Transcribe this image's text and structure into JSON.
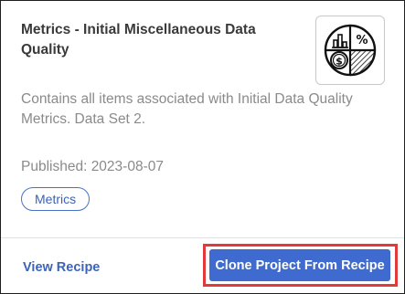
{
  "card": {
    "title": "Metrics - Initial Miscellaneous Data Quality",
    "description": "Contains all items associated with Initial Data Quality Metrics. Data Set 2.",
    "published": "Published: 2023-08-07",
    "tag": "Metrics",
    "icon": "metrics-pie-chart-icon"
  },
  "footer": {
    "view_label": "View Recipe",
    "clone_label": "Clone Project From Recipe"
  },
  "colors": {
    "accent": "#3f6bd0",
    "link": "#3d63b8",
    "highlight": "#e03a3a",
    "muted_text": "#8a8a8a"
  }
}
